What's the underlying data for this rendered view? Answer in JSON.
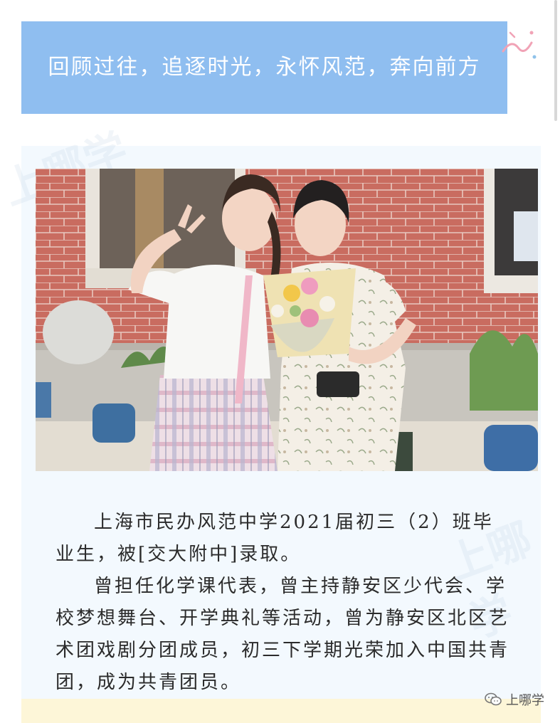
{
  "banner": {
    "title": "回顾过往，追逐时光，永怀风范，奔向前方"
  },
  "watermark": {
    "text": "上哪学"
  },
  "article": {
    "paragraphs": [
      "上海市民办风范中学2021届初三（2）班毕业生，被[交大附中]录取。",
      "曾担任化学课代表，曾主持静安区少代会、学校梦想舞台、开学典礼等活动，曾为静安区北区艺术团戏剧分团成员，初三下学期光荣加入中国共青团，成为共青团员。"
    ]
  },
  "brand": {
    "name": "上哪学",
    "icon": "wechat-icon"
  },
  "colors": {
    "banner_bg": "#8fbef0",
    "panel_bg": "#f3f9fe",
    "strip_bg": "#fdf6d8",
    "brick": "#c0645a"
  }
}
